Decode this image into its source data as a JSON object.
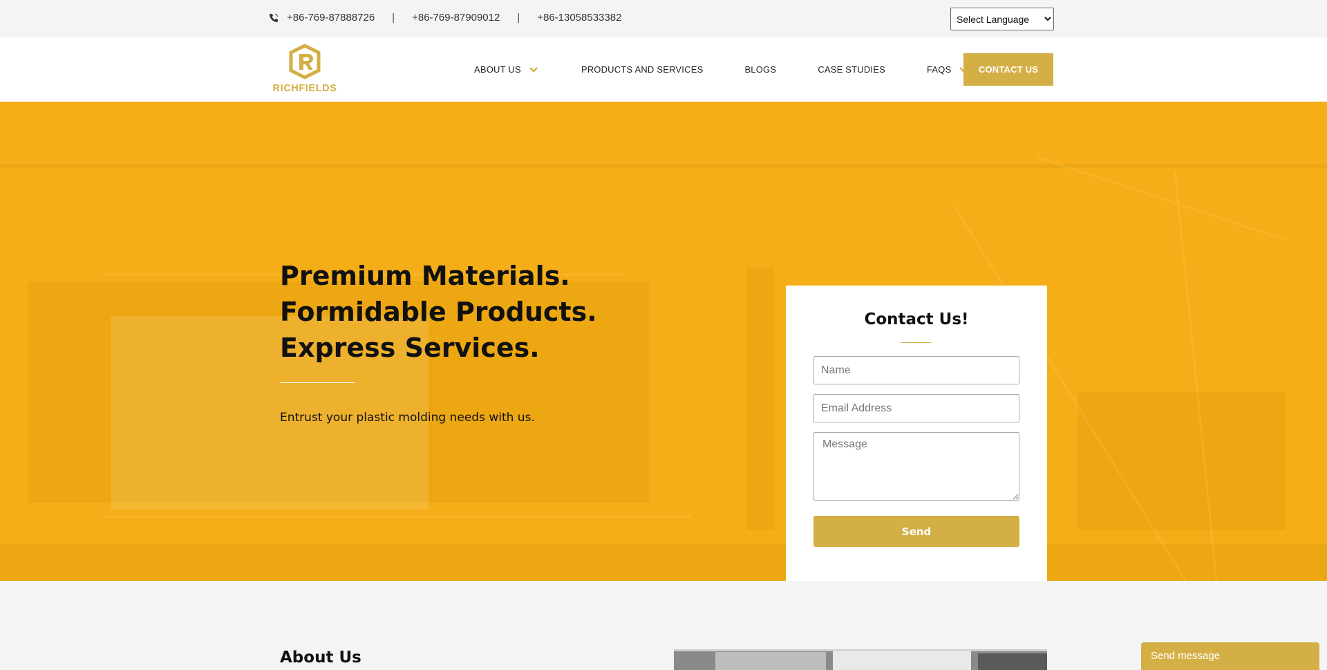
{
  "topbar": {
    "phones": [
      "+86-769-87888726",
      "+86-769-87909012",
      "+86-13058533382"
    ],
    "separator": "|",
    "language_select": "Select Language"
  },
  "header": {
    "logo_text": "RICHFIELDS",
    "nav": [
      {
        "label": "ABOUT US",
        "has_dropdown": true
      },
      {
        "label": "PRODUCTS AND SERVICES",
        "has_dropdown": false
      },
      {
        "label": "BLOGS",
        "has_dropdown": false
      },
      {
        "label": "CASE STUDIES",
        "has_dropdown": false
      },
      {
        "label": "FAQS",
        "has_dropdown": true
      }
    ],
    "contact_button": "CONTACT US"
  },
  "hero": {
    "title_lines": [
      "Premium Materials.",
      "Formidable Products.",
      "Express Services."
    ],
    "subtitle": "Entrust your plastic molding needs with us."
  },
  "contact_form": {
    "title": "Contact Us!",
    "name_placeholder": "Name",
    "email_placeholder": "Email Address",
    "message_placeholder": "Message",
    "send_label": "Send"
  },
  "about": {
    "title": "About Us"
  },
  "chat_widget": {
    "label": "Send message"
  },
  "colors": {
    "accent": "#d4af45",
    "hero_bg": "#f5ae17",
    "topbar_bg": "#f4f4f4"
  }
}
